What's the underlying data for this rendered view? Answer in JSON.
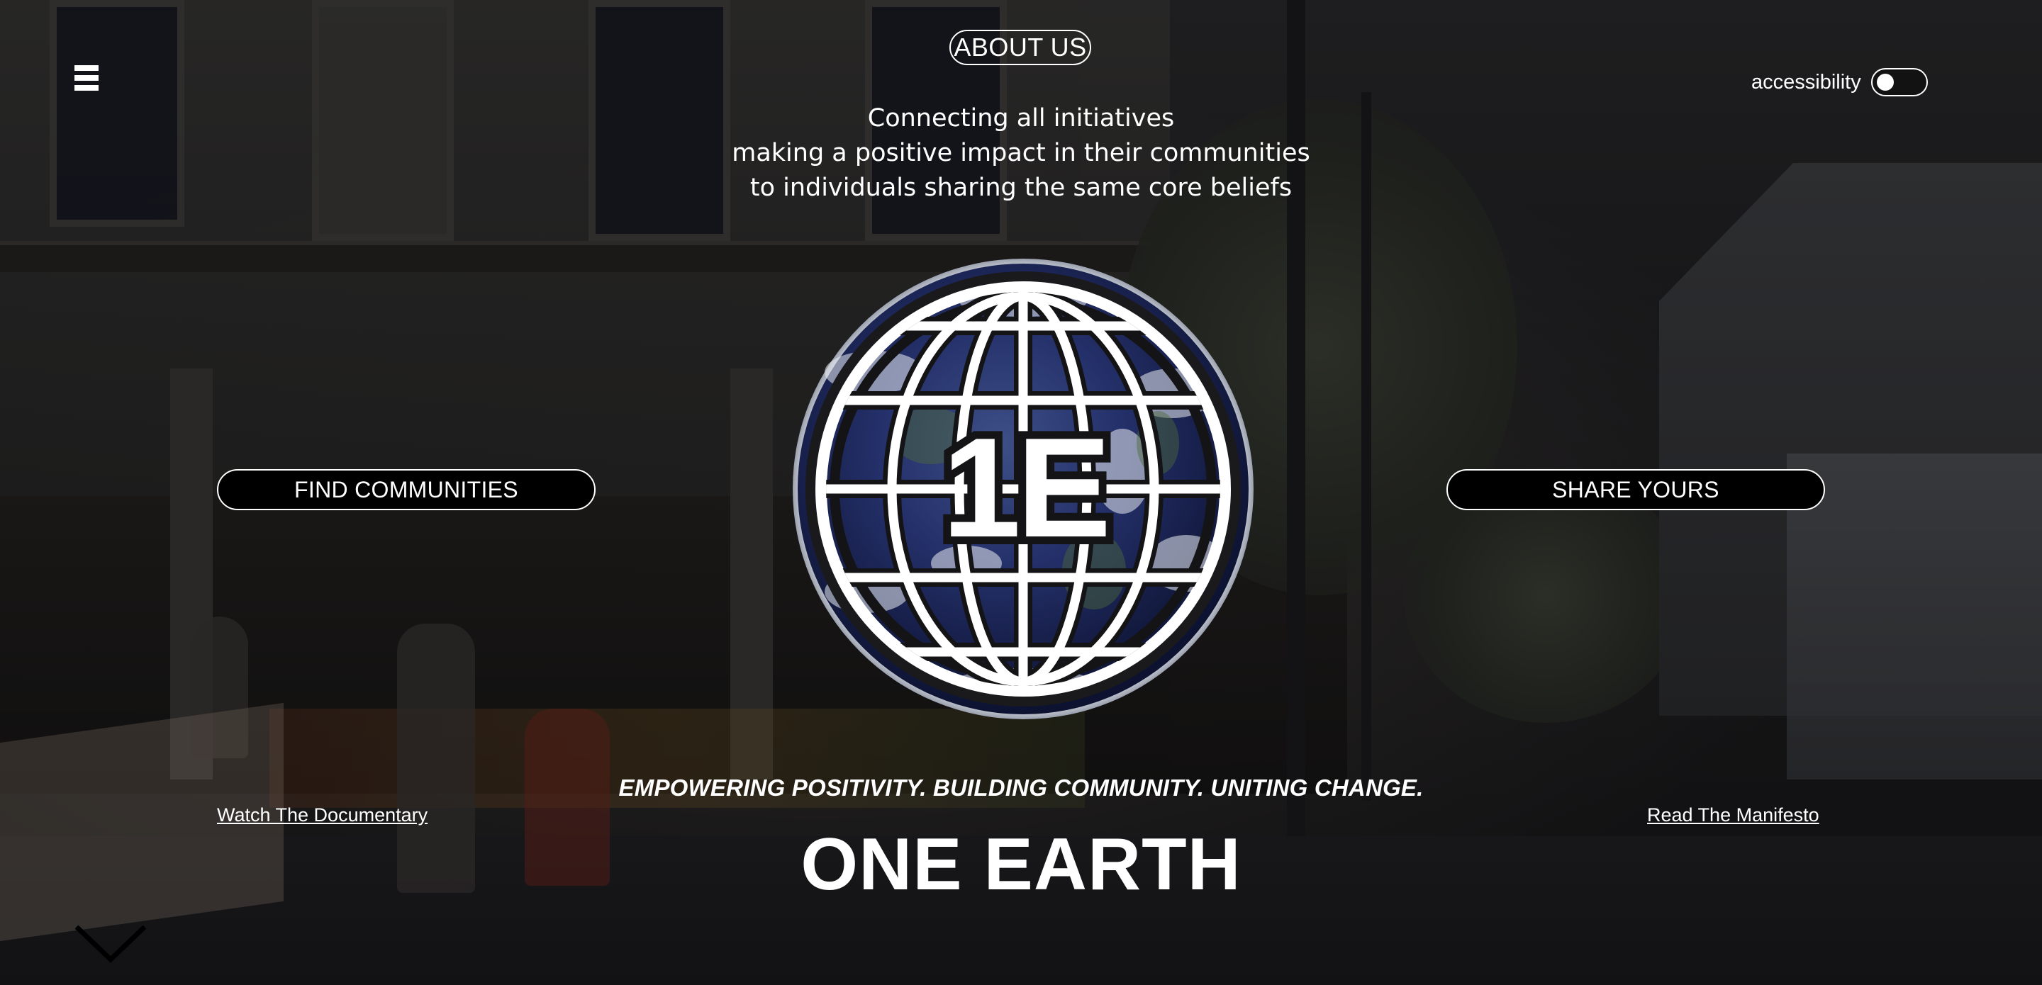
{
  "header": {
    "menu_icon": "hamburger-menu-icon",
    "about_label": "ABOUT US",
    "accessibility_label": "accessibility",
    "accessibility_on": false
  },
  "tagline": {
    "line1": "Connecting all initiatives",
    "line2": "making a positive impact in their communities",
    "line3": "to individuals sharing the same core beliefs"
  },
  "actions": {
    "find_label": "FIND COMMUNITIES",
    "share_label": "SHARE YOURS"
  },
  "logo": {
    "text": "1E",
    "icon": "globe-logo-icon"
  },
  "links": {
    "documentary": "Watch The Documentary",
    "manifesto": "Read The Manifesto"
  },
  "motto": "EMPOWERING POSITIVITY. BUILDING COMMUNITY. UNITING CHANGE.",
  "brand": "ONE EARTH",
  "scroll_icon": "chevron-down-icon"
}
